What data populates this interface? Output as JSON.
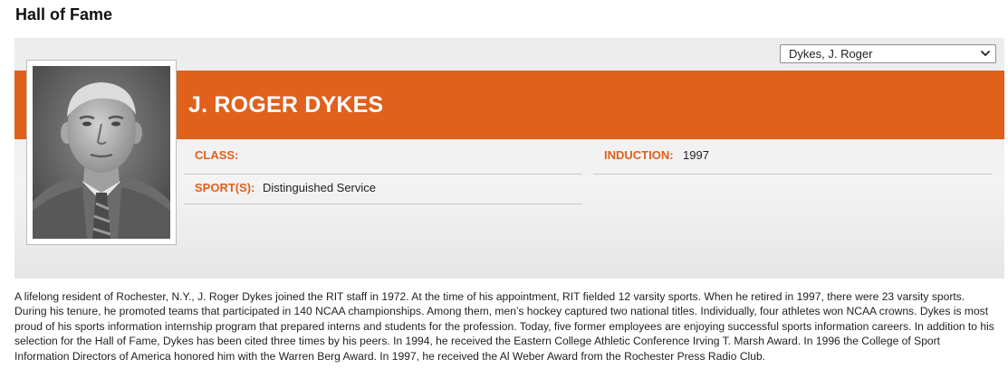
{
  "page": {
    "title": "Hall of Fame"
  },
  "selector": {
    "selected": "Dykes, J. Roger"
  },
  "profile": {
    "name": "J. ROGER DYKES",
    "photo_icon": "portrait-photo",
    "fields": {
      "class_label": "CLASS:",
      "class_value": "",
      "sport_label": "SPORT(S):",
      "sport_value": "Distinguished Service",
      "induction_label": "INDUCTION:",
      "induction_value": "1997"
    }
  },
  "bio": {
    "text": "A lifelong resident of Rochester, N.Y., J. Roger Dykes joined the RIT staff in 1972. At the time of his appointment, RIT fielded 12 varsity sports. When he retired in 1997, there were 23 varsity sports. During his tenure, he promoted teams that participated in 140 NCAA championships. Among them, men’s hockey captured two national titles. Individually, four athletes won NCAA crowns. Dykes is most proud of his sports information internship program that prepared interns and students for the profession. Today, five former employees are enjoying successful sports information careers. In addition to his selection for the Hall of Fame, Dykes has been cited three times by his peers. In 1994, he received the Eastern College Athletic Conference Irving T. Marsh Award. In 1996 the College of Sport Information Directors of America honored him with the Warren Berg Award. In 1997, he received the Al Weber Award from the Rochester Press Radio Club."
  },
  "colors": {
    "accent": "#e0601c",
    "panel": "#eeeeee",
    "text": "#222222"
  }
}
